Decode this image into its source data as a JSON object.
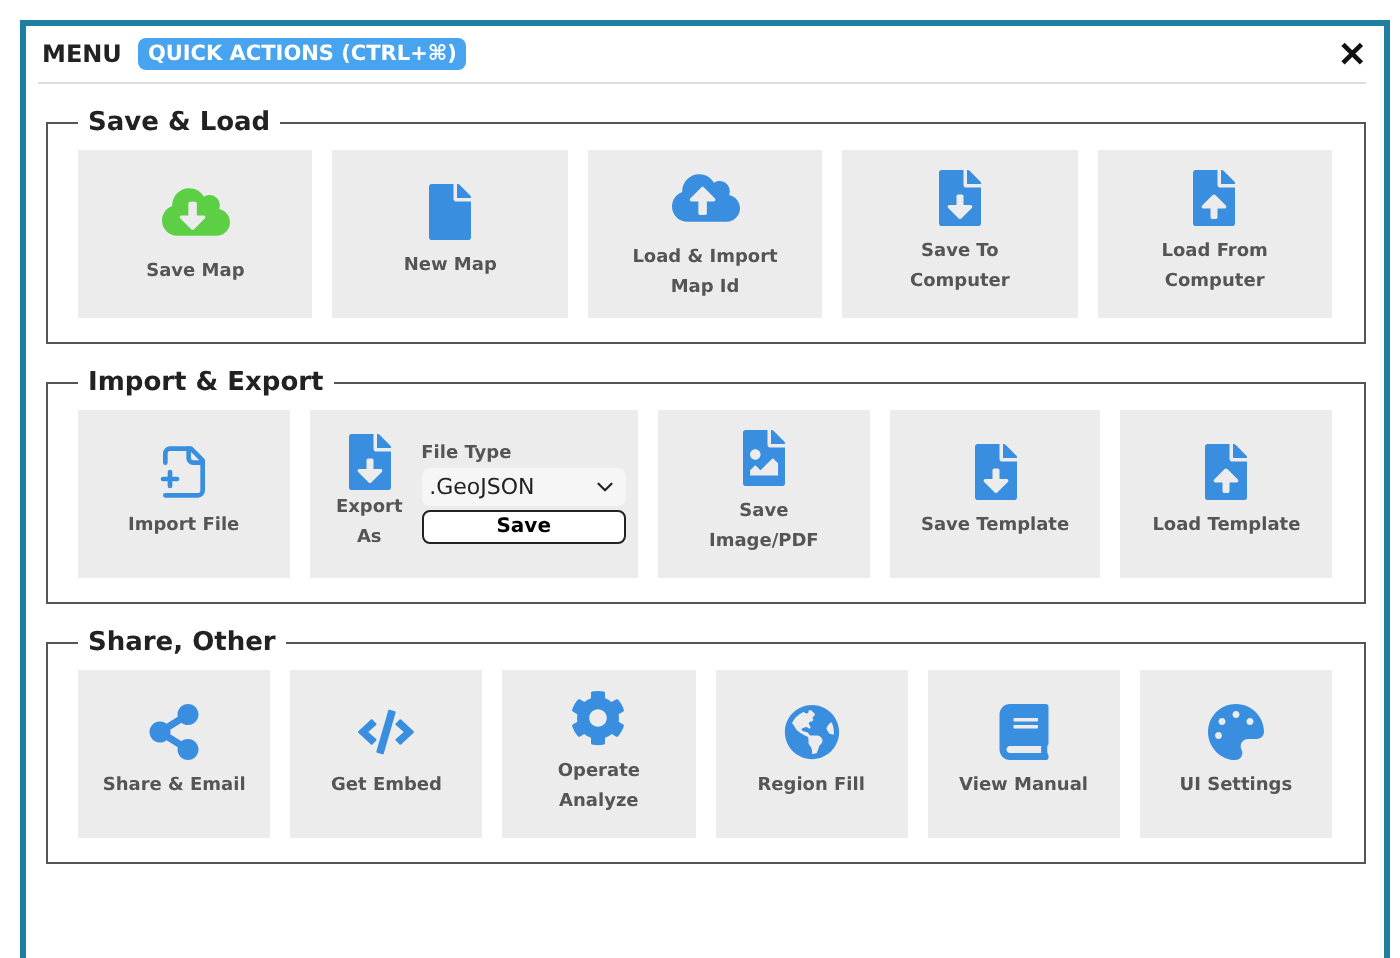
{
  "header": {
    "title": "MENU",
    "badge": "QUICK ACTIONS (CTRL+⌘)",
    "close": "✕"
  },
  "sections": [
    {
      "title": "Save & Load",
      "tiles": [
        {
          "kind": "cloud-down",
          "label": "Save Map",
          "color": "#5ccf45"
        },
        {
          "kind": "file",
          "label": "New Map",
          "color": "#3a8ee0"
        },
        {
          "kind": "cloud-up",
          "label": "Load & Import Map Id",
          "color": "#3a8ee0"
        },
        {
          "kind": "file-down",
          "label": "Save To Computer",
          "color": "#3a8ee0"
        },
        {
          "kind": "file-up",
          "label": "Load From Computer",
          "color": "#3a8ee0"
        }
      ]
    },
    {
      "title": "Import & Export",
      "tiles": [
        {
          "kind": "file-plus",
          "label": "Import File",
          "color": "#3a8ee0"
        },
        {
          "kind": "export",
          "label": "Export As",
          "color": "#3a8ee0",
          "field_label": "File Type",
          "value": ".GeoJSON",
          "button": "Save"
        },
        {
          "kind": "file-image",
          "label": "Save Image/PDF",
          "color": "#3a8ee0"
        },
        {
          "kind": "template-down",
          "label": "Save Template",
          "color": "#3a8ee0"
        },
        {
          "kind": "template-up",
          "label": "Load Template",
          "color": "#3a8ee0"
        }
      ]
    },
    {
      "title": "Share, Other",
      "tiles": [
        {
          "kind": "share",
          "label": "Share & Email",
          "color": "#3a8ee0"
        },
        {
          "kind": "code",
          "label": "Get Embed",
          "color": "#3a8ee0"
        },
        {
          "kind": "gear",
          "label": "Operate Analyze",
          "color": "#3a8ee0"
        },
        {
          "kind": "globe",
          "label": "Region Fill",
          "color": "#3a8ee0"
        },
        {
          "kind": "book",
          "label": "View Manual",
          "color": "#3a8ee0"
        },
        {
          "kind": "palette",
          "label": "UI Settings",
          "color": "#3a8ee0"
        }
      ]
    }
  ]
}
